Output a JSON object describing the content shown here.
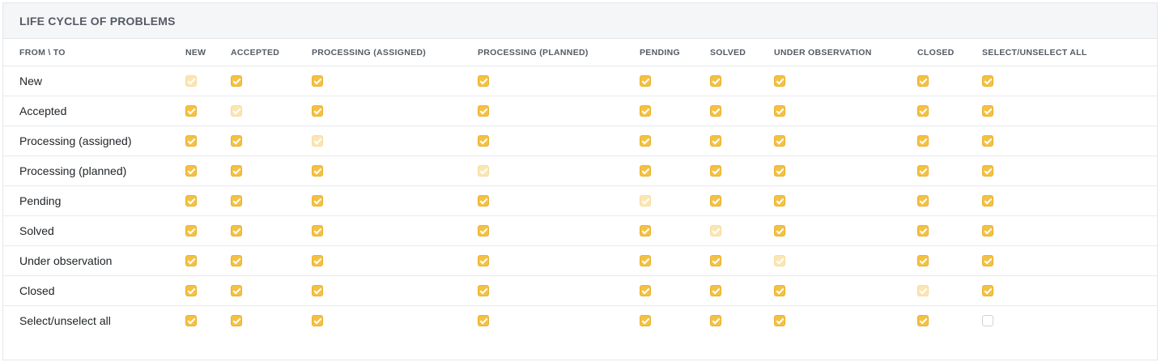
{
  "panel": {
    "title": "LIFE CYCLE OF PROBLEMS"
  },
  "columns": [
    "FROM \\ TO",
    "NEW",
    "ACCEPTED",
    "PROCESSING (ASSIGNED)",
    "PROCESSING (PLANNED)",
    "PENDING",
    "SOLVED",
    "UNDER OBSERVATION",
    "CLOSED",
    "SELECT/UNSELECT ALL"
  ],
  "rows": [
    {
      "label": "New",
      "cells": [
        "disabled",
        "checked",
        "checked",
        "checked",
        "checked",
        "checked",
        "checked",
        "checked",
        "checked"
      ]
    },
    {
      "label": "Accepted",
      "cells": [
        "checked",
        "disabled",
        "checked",
        "checked",
        "checked",
        "checked",
        "checked",
        "checked",
        "checked"
      ]
    },
    {
      "label": "Processing (assigned)",
      "cells": [
        "checked",
        "checked",
        "disabled",
        "checked",
        "checked",
        "checked",
        "checked",
        "checked",
        "checked"
      ]
    },
    {
      "label": "Processing (planned)",
      "cells": [
        "checked",
        "checked",
        "checked",
        "disabled",
        "checked",
        "checked",
        "checked",
        "checked",
        "checked"
      ]
    },
    {
      "label": "Pending",
      "cells": [
        "checked",
        "checked",
        "checked",
        "checked",
        "disabled",
        "checked",
        "checked",
        "checked",
        "checked"
      ]
    },
    {
      "label": "Solved",
      "cells": [
        "checked",
        "checked",
        "checked",
        "checked",
        "checked",
        "disabled",
        "checked",
        "checked",
        "checked"
      ]
    },
    {
      "label": "Under observation",
      "cells": [
        "checked",
        "checked",
        "checked",
        "checked",
        "checked",
        "checked",
        "disabled",
        "checked",
        "checked"
      ]
    },
    {
      "label": "Closed",
      "cells": [
        "checked",
        "checked",
        "checked",
        "checked",
        "checked",
        "checked",
        "checked",
        "disabled",
        "checked"
      ]
    },
    {
      "label": "Select/unselect all",
      "cells": [
        "checked",
        "checked",
        "checked",
        "checked",
        "checked",
        "checked",
        "checked",
        "checked",
        "unchecked"
      ]
    }
  ],
  "colors": {
    "checkbox_checked": "#f5c142",
    "checkbox_disabled": "#fbe6b3",
    "header_bg": "#f5f6f8"
  }
}
